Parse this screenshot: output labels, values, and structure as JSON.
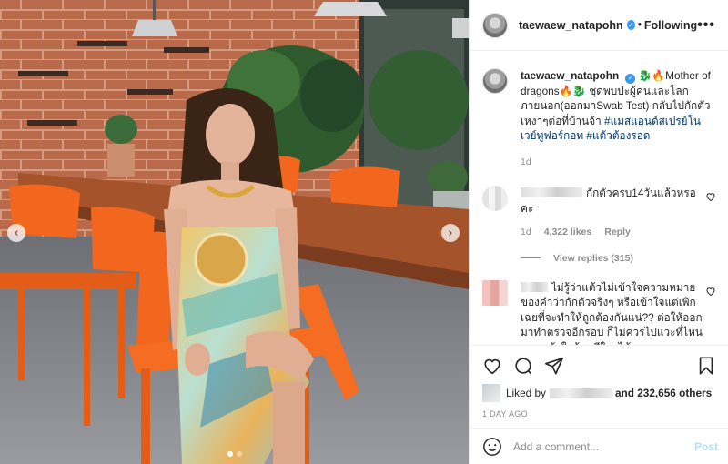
{
  "header": {
    "username": "taewaew_natapohn",
    "separator": "•",
    "follow_label": "Following",
    "more_label": "•••"
  },
  "caption": {
    "username": "taewaew_natapohn",
    "text": "🐉🔥Mother of dragons🔥🐉 ชุดพบปะผู้คนและโลกภายนอก(ออกมาSwab Test) กลับไปกักตัวเหงาๆต่อที่บ้านจ้า",
    "hashtags": "#แมสแอนด์สเปรย์โนเวย์ทูฟอร์กอท #แต้วต้องรอด",
    "time": "1d"
  },
  "comments": [
    {
      "text": "กักตัวครบ14วันแล้วหรอคะ",
      "time": "1d",
      "likes": "4,322 likes",
      "reply_label": "Reply",
      "view_replies": "View replies (315)"
    },
    {
      "text": "ไม่รู้ว่าแต้วไม่เข้าใจความหมายของคำว่ากักตัวจริงๆ หรือเข้าใจแต่เพิกเฉยที่จะทำให้ถูกต้องกันแน่?? ต่อให้ออกมาทำตรวจอีกรอบ ก็ไม่ควรไปแวะที่ไหน เพราะถ้าในร้านมีใครได้"
    }
  ],
  "likes": {
    "prefix": "Liked by",
    "and_others": "and 232,656 others"
  },
  "post_time": "1 DAY AGO",
  "add_comment": {
    "placeholder": "Add a comment...",
    "post_label": "Post"
  },
  "photo": {
    "prev_arrow": "‹",
    "next_arrow": "›",
    "dot_count": 2,
    "active_dot": 1
  },
  "colors": {
    "verified": "#3897f0",
    "hashtag": "#00376b",
    "post_button_disabled": "#b2dffc",
    "chair": "#f2661e",
    "brick": "#b86a4b"
  }
}
